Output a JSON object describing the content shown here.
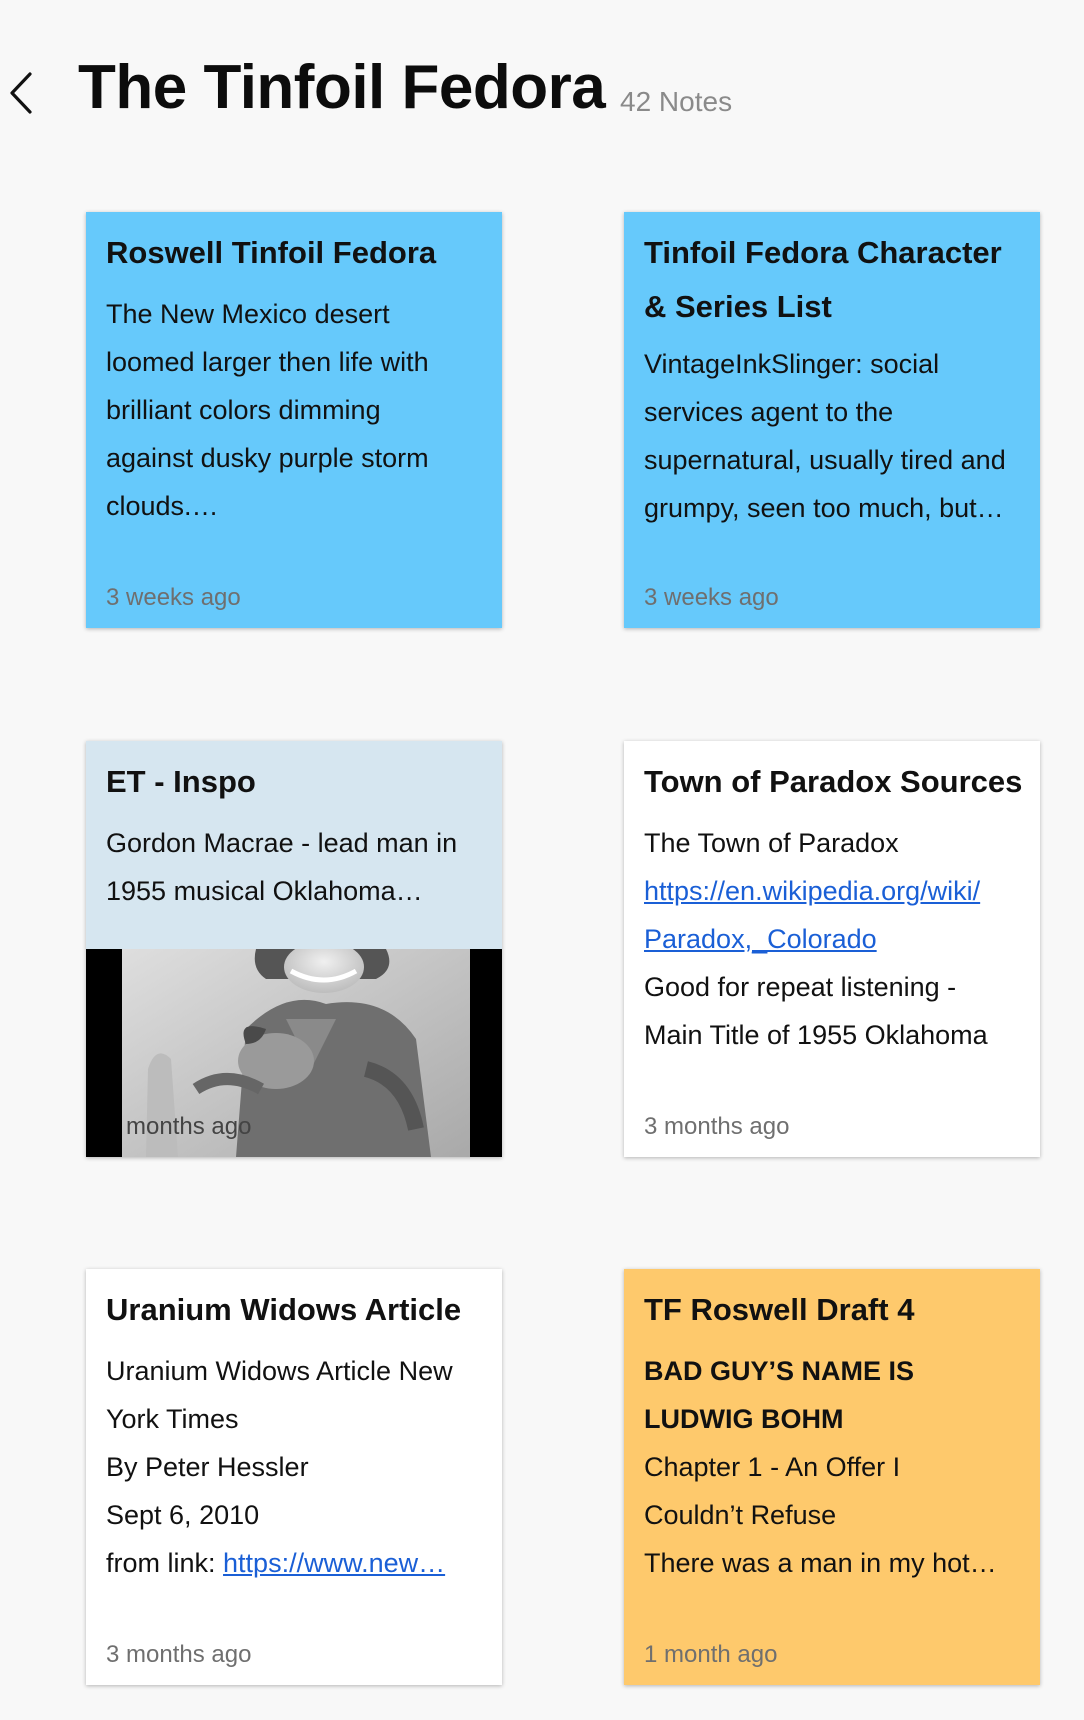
{
  "header": {
    "title": "The Tinfoil Fedora",
    "note_count": "42 Notes"
  },
  "colors": {
    "blue_card": "#66c9fb",
    "light_blue_card": "#d6e6f0",
    "white_card": "#ffffff",
    "orange_card": "#fec96c",
    "link": "#1a5fd6"
  },
  "notes": [
    {
      "title": "Roswell Tinfoil Fedora",
      "lines": [
        "The New Mexico desert",
        "loomed larger then life with",
        "brilliant colors dimming",
        "against dusky purple storm",
        "clouds.…"
      ],
      "time": "3 weeks ago"
    },
    {
      "title_line1": "Tinfoil Fedora Character",
      "title_line2": "& Series List",
      "lines": [
        "VintageInkSlinger: social",
        "services agent to the",
        "supernatural, usually tired and",
        "grumpy, seen too much, but…"
      ],
      "time": "3 weeks ago"
    },
    {
      "title": "ET - Inspo",
      "lines": [
        "Gordon Macrae - lead man in",
        "1955 musical Oklahoma…"
      ],
      "time": "months ago",
      "image": "black-and-white photo of a smiling man in a cowboy hat"
    },
    {
      "title": "Town of Paradox Sources",
      "line1": "The Town of Paradox",
      "link_line1": "https://en.wikipedia.org/wiki/",
      "link_line2": "Paradox,_Colorado",
      "line4": "Good for repeat listening -",
      "line5": "Main Title of 1955 Oklahoma",
      "time": "3 months ago"
    },
    {
      "title": "Uranium Widows Article",
      "lines": [
        "Uranium Widows Article New",
        "York Times",
        "By Peter Hessler",
        "Sept 6, 2010"
      ],
      "link_prefix": "from link: ",
      "link_text": "https://www.new…",
      "time": "3 months ago"
    },
    {
      "title": "TF Roswell Draft 4",
      "bold_lines": [
        "BAD GUY’S NAME IS",
        "LUDWIG BOHM"
      ],
      "lines": [
        "Chapter 1 - An Offer I",
        "Couldn’t Refuse",
        "There was a man in my hot…"
      ],
      "time": "1 month ago"
    }
  ]
}
